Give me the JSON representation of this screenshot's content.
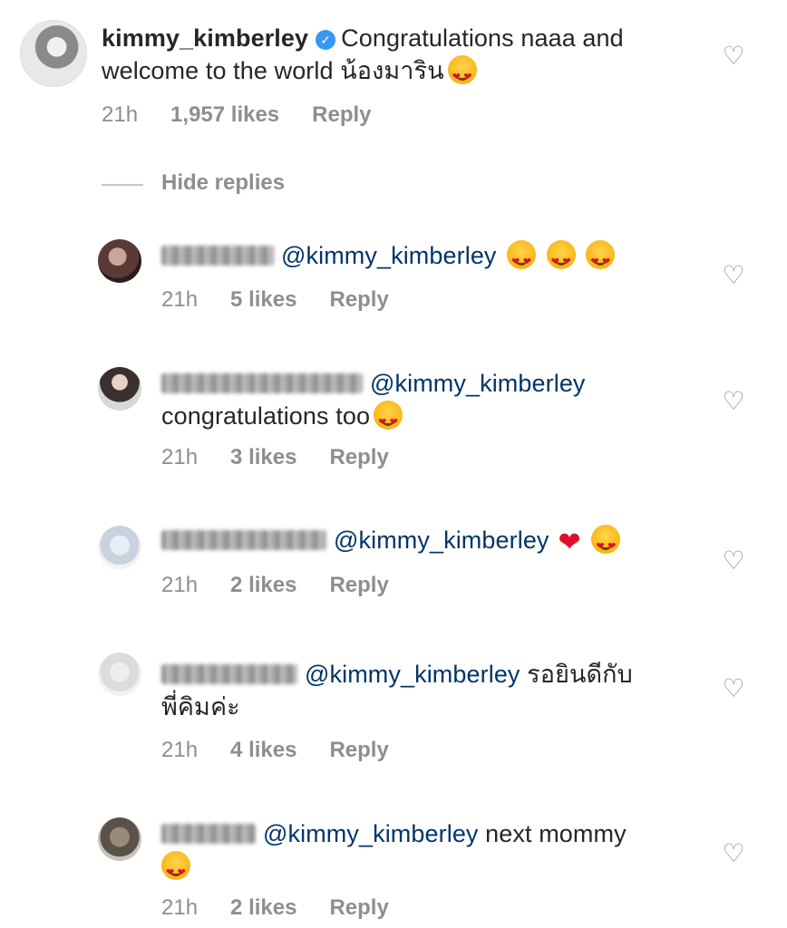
{
  "main_comment": {
    "username": "kimmy_kimberley",
    "text_line1": "Congratulations naaa and",
    "text_line2": "welcome to the world น้องมาริน",
    "time": "21h",
    "likes": "1,957 likes",
    "reply": "Reply"
  },
  "hide_replies_label": "Hide replies",
  "replies": [
    {
      "mention": "@kimmy_kimberley",
      "text": "",
      "time": "21h",
      "likes": "5 likes",
      "reply": "Reply"
    },
    {
      "mention": "@kimmy_kimberley",
      "text": "congratulations too",
      "time": "21h",
      "likes": "3 likes",
      "reply": "Reply"
    },
    {
      "mention": "@kimmy_kimberley",
      "text": "",
      "time": "21h",
      "likes": "2 likes",
      "reply": "Reply"
    },
    {
      "mention": "@kimmy_kimberley",
      "text": "รอยินดีกับ",
      "text2": "พี่คิมค่ะ",
      "time": "21h",
      "likes": "4 likes",
      "reply": "Reply"
    },
    {
      "mention": "@kimmy_kimberley",
      "text": "next mommy",
      "time": "21h",
      "likes": "2 likes",
      "reply": "Reply"
    }
  ],
  "icons": {
    "like": "heart-outline-icon",
    "verified": "verified-badge-icon"
  },
  "colors": {
    "mention": "#003569",
    "meta": "#8e8e8e",
    "verified": "#3897f0"
  }
}
